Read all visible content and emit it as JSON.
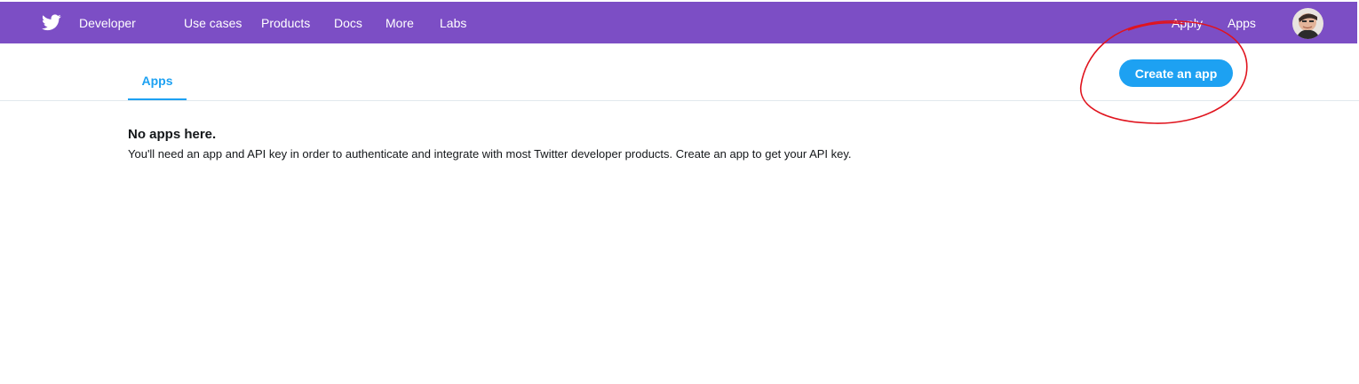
{
  "topbar": {
    "brand": "Developer",
    "nav_left": [
      "Use cases",
      "Products",
      "Docs",
      "More",
      "Labs"
    ],
    "nav_right": [
      "Apply",
      "Apps"
    ],
    "background_color": "#7c4ec5"
  },
  "tabs": {
    "active": "Apps"
  },
  "actions": {
    "create_app_label": "Create an app",
    "accent_color": "#1da1f2"
  },
  "empty_state": {
    "title": "No apps here.",
    "description": "You'll need an app and API key in order to authenticate and integrate with most Twitter developer products. Create an app to get your API key."
  },
  "annotation": {
    "shape": "hand-drawn ellipse around create button",
    "color": "#e0141e"
  }
}
